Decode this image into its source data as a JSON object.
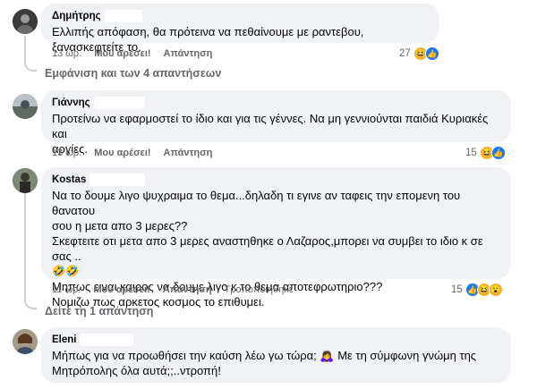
{
  "comments": [
    {
      "author": "Δημήτρης",
      "text_lines": [
        "Ελλιπής απόφαση, θα πρότεινα να πεθαίνουμε με ραντεβου, ξανασκεφτείτε το."
      ],
      "time": "13 ώρ.",
      "like_label": "Μου αρέσει!",
      "reply_label": "Απάντηση",
      "reaction_count": "27",
      "reactions": [
        "haha",
        "like"
      ],
      "replies_label": "Εμφάνιση και των 4 απαντήσεων"
    },
    {
      "author": "Γιάννης",
      "text_lines": [
        "Προτείνω να εφαρμοστεί το ίδιο και για τις γέννες. Να μη γεννιούνται παιδιά Κυριακές και",
        "αργίες."
      ],
      "time": "13 ώρ.",
      "like_label": "Μου αρέσει!",
      "reply_label": "Απάντηση",
      "reaction_count": "15",
      "reactions": [
        "haha",
        "like"
      ]
    },
    {
      "author": "Kostas",
      "text_lines": [
        "Να το δουμε λιγο ψυχραιμα το θεμα...δηλαδη τι εγινε αν ταφεις την επομενη του θανατου",
        "σου η μετα απο 3 μερες??",
        "Σκεφτειτε οτι μετα απο 3 μερες αναστηθηκε ο Λαζαρος,μπορει να συμβει το ιδιο κ σε σας ..",
        "🤣🤣",
        "Μηπως ειναι καιρος να δουμε λιγο κ το θεμα αποτεφρωτηριο???",
        "Νομιζω πως αρκετος κοσμος το επιθυμει."
      ],
      "time": "11 ώρ.",
      "like_label": "Μου αρέσει!",
      "reply_label": "Απάντηση",
      "edited_label": "Τροποποιήθηκε",
      "reaction_count": "15",
      "reactions": [
        "like",
        "haha",
        "wow"
      ],
      "replies_label": "Δείτε τη 1 απάντηση"
    },
    {
      "author": "Eleni",
      "text_lines": [
        "Μήπως για να προωθήσει την καύση λέω γω τώρα; 🙇‍♀️ Με τη σύμφωνη γνώμη της",
        "Μητρόπολης όλα αυτά;;..ντροπή!"
      ]
    }
  ],
  "colors": {
    "bubble": "#f0f2f5",
    "meta_text": "#65676b",
    "like_blue": "#1877f2",
    "haha_yellow": "#f7b125"
  }
}
